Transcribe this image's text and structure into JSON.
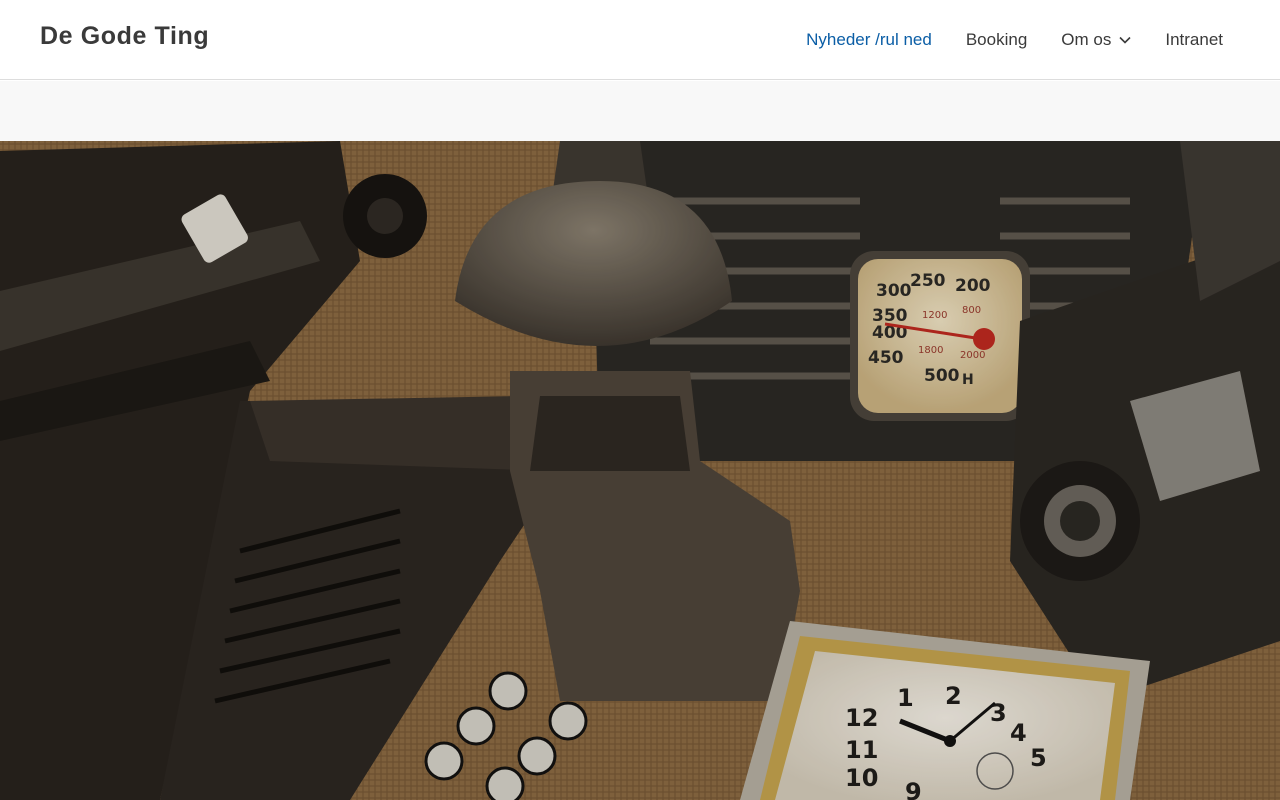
{
  "site": {
    "title": "De Gode Ting"
  },
  "nav": {
    "items": [
      {
        "label": "Nyheder /rul ned",
        "active": true
      },
      {
        "label": "Booking",
        "active": false
      },
      {
        "label": "Om os",
        "active": false,
        "has_dropdown": true,
        "icon": "chevron-down-icon"
      },
      {
        "label": "Intranet",
        "active": false
      }
    ]
  },
  "hero": {
    "radio_dial": [
      "250",
      "200",
      "300",
      "350",
      "400",
      "450",
      "500",
      "1200",
      "800",
      "1800",
      "2000",
      "H"
    ],
    "clock_digits": [
      "12",
      "1",
      "2",
      "3",
      "4",
      "5",
      "10",
      "11",
      "9"
    ]
  },
  "colors": {
    "accent": "#0b5ea6",
    "text": "#3a3a3a",
    "band": "#f8f8f8",
    "border": "#dddddd"
  }
}
